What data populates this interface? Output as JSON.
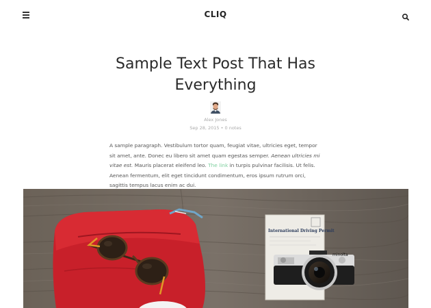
{
  "header": {
    "logo": "CLIQ",
    "menu_icon": "hamburger-menu-icon",
    "search_icon": "search-icon"
  },
  "post": {
    "title": "Sample Text Post That Has Everything",
    "author": "Alex Jones",
    "date": "Sep 28, 2015",
    "notes": "0 notes",
    "body": {
      "part1": "A sample paragraph. Vestibulum tortor quam, feugiat vitae, ultricies eget, tempor sit amet, ante. Donec eu libero sit amet quam egestas semper. ",
      "italic": "Aenean ultricies mi vitae est.",
      "part2": " Mauris placerat eleifend leo. ",
      "link": "The link",
      "part3": " in turpis pulvinar facilisis. Ut felis. Aenean fermentum, elit eget tincidunt condimentum, eros ipsum rutrum orci, sagittis tempus lacus enim ac dui."
    },
    "photo": {
      "permit_title": "International Driving Permit",
      "camera_brand": "minolta"
    }
  },
  "colors": {
    "link": "#7dcf9e",
    "text": "#555555",
    "title": "#2a2a2a",
    "meta": "#aaaaaa"
  }
}
